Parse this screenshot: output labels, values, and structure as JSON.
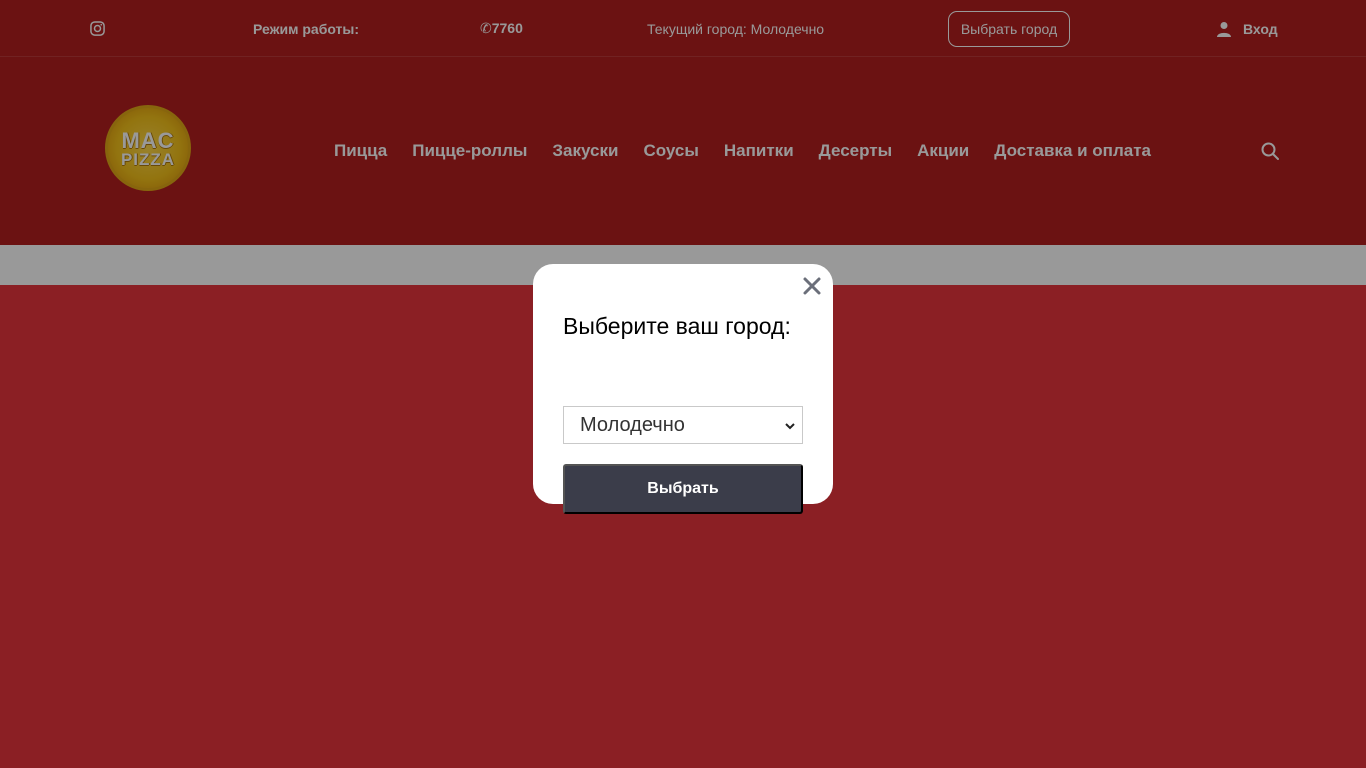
{
  "topbar": {
    "hours_label": "Режим работы:",
    "phone": "✆7760",
    "current_city": "Текущий город: Молодечно",
    "choose_city_button": "Выбрать город",
    "login_label": "Вход"
  },
  "header": {
    "logo_line1": "MAC",
    "logo_line2": "PIZZA",
    "nav": [
      "Пицца",
      "Пицце-роллы",
      "Закуски",
      "Соусы",
      "Напитки",
      "Десерты",
      "Акции",
      "Доставка и оплата"
    ]
  },
  "modal": {
    "title": "Выберите ваш город:",
    "select_value": "Молодечно",
    "submit_label": "Выбрать"
  },
  "colors": {
    "brand_red": "#b31e1e",
    "content_red": "#e8343c",
    "button_dark": "#3b3d4a",
    "overlay": "rgba(0,0,0,0.4)"
  },
  "icons": [
    "instagram-icon",
    "user-icon",
    "search-icon",
    "close-icon",
    "chevron-down-icon"
  ]
}
